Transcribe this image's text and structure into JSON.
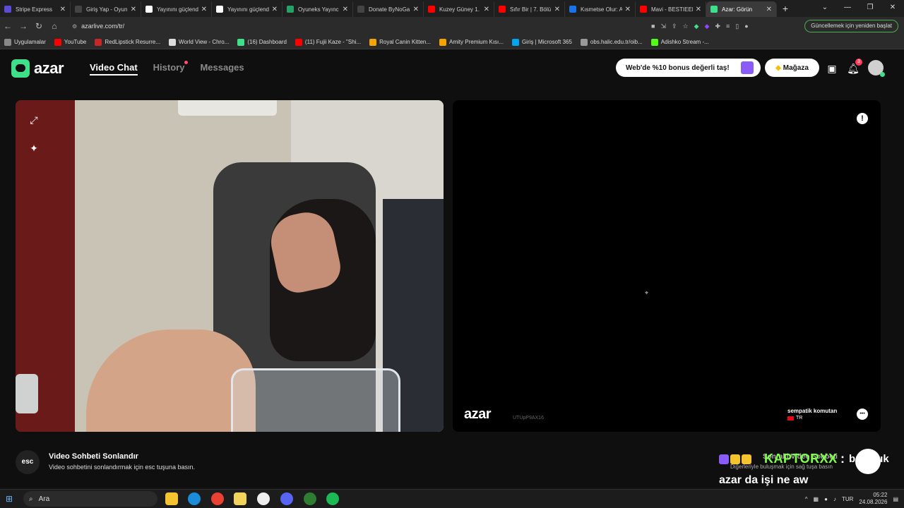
{
  "browser": {
    "tabs": [
      {
        "title": "Stripe Express",
        "color": "#5b4bd6"
      },
      {
        "title": "Giriş Yap - Oyun",
        "color": "#444444"
      },
      {
        "title": "Yayınını güçlend",
        "color": "#ffffff"
      },
      {
        "title": "Yayınını güçlend",
        "color": "#ffffff"
      },
      {
        "title": "Oyuneks Yayınc",
        "color": "#26a269"
      },
      {
        "title": "Donate ByNoGa",
        "color": "#444444"
      },
      {
        "title": "Kuzey Güney 1.",
        "color": "#ff0000"
      },
      {
        "title": "Sıfır Bir | 7. Bölü",
        "color": "#ff0000"
      },
      {
        "title": "Kısmetse Olur: A",
        "color": "#1a73e8"
      },
      {
        "title": "Mavi - BESTIEEE",
        "color": "#ff0000"
      },
      {
        "title": "Azar: Görün",
        "color": "#3ee08a",
        "active": true
      }
    ],
    "new_tab": "+",
    "url": "azarlive.com/tr/",
    "update_button": "Güncellemek için yeniden başlat",
    "bookmarks": [
      {
        "label": "Uygulamalar",
        "color": "#888888"
      },
      {
        "label": "YouTube",
        "color": "#ff0000"
      },
      {
        "label": "RedLipstick Resurre...",
        "color": "#c62828"
      },
      {
        "label": "World View - Chro...",
        "color": "#dddddd"
      },
      {
        "label": "(16) Dashboard",
        "color": "#3ee08a"
      },
      {
        "label": "(11) Fujii Kaze - \"Shi...",
        "color": "#ff0000"
      },
      {
        "label": "Royal Canin Kitten...",
        "color": "#f4a300"
      },
      {
        "label": "Amity Premium Kısı...",
        "color": "#f4a300"
      },
      {
        "label": "Giriş | Microsoft 365",
        "color": "#00a4ef"
      },
      {
        "label": "obs.halic.edu.tr/oib...",
        "color": "#999999"
      },
      {
        "label": "Adishko Stream -...",
        "color": "#53fc18"
      }
    ]
  },
  "app": {
    "logo": "azar",
    "nav": {
      "video_chat": "Video Chat",
      "history": "History",
      "messages": "Messages"
    },
    "promo": "Web'de %10 bonus değerli taş!",
    "store": "Mağaza",
    "notification_count": "3"
  },
  "peer": {
    "watermark": "azar",
    "watermark_id": "UTUpP9AX16",
    "name": "sempatik komutan",
    "country": "TR"
  },
  "hints": {
    "esc_key": "esc",
    "end_title": "Video Sohbeti Sonlandır",
    "end_desc": "Video sohbetini sonlandırmak için esc tuşuna basın.",
    "next_title": "Sonraki Video Sohbeti",
    "next_desc": "Diğerleriyle buluşmak için sağ tuşa basın"
  },
  "overlay": {
    "username": "KAPTORXX",
    "separator": ":",
    "message_line1": "bulavuk",
    "message_line2": "azar da işi ne aw"
  },
  "taskbar": {
    "search_placeholder": "Ara",
    "language": "TUR",
    "time": "05:22",
    "date": "24.08.2026"
  }
}
